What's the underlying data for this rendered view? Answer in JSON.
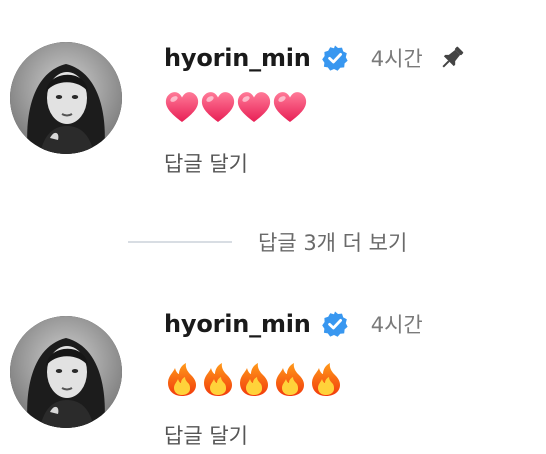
{
  "comments": [
    {
      "username": "hyorin_min",
      "verified": true,
      "time": "4시간",
      "pinned": true,
      "reactions": [
        "heart",
        "heart",
        "heart",
        "heart"
      ],
      "reply_label": "답글 달기"
    },
    {
      "username": "hyorin_min",
      "verified": true,
      "time": "4시간",
      "pinned": false,
      "reactions": [
        "fire",
        "fire",
        "fire",
        "fire",
        "fire"
      ],
      "reply_label": "답글 달기"
    }
  ],
  "view_replies": {
    "label": "답글 3개 더 보기"
  },
  "colors": {
    "verified_blue": "#3897f0",
    "heart_pink": "#f0406b",
    "fire_orange": "#ff7a1a",
    "secondary_text": "#7a7a7a"
  },
  "icons": {
    "verified": "verified-badge-icon",
    "pin": "pin-icon",
    "heart": "red-heart-emoji",
    "fire": "fire-emoji"
  }
}
